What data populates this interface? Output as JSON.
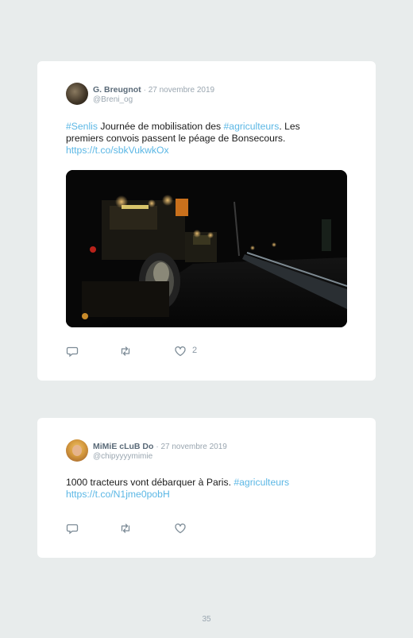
{
  "tweets": [
    {
      "author": "G. Breugnot",
      "date": "· 27 novembre 2019",
      "handle": "@Breni_og",
      "hashtag1": "#Senlis",
      "text1": " Journée de mobilisation des ",
      "hashtag2": "#agriculteurs",
      "text2": ". Les premiers convois passent le péage de Bonsecours.",
      "link": "https://t.co/sbkVukwkOx",
      "likes": "2"
    },
    {
      "author": "MiMiE cLuB Do",
      "date": "· 27 novembre 2019",
      "handle": "@chipyyyymimie",
      "text1": "1000 tracteurs vont débarquer à Paris. ",
      "hashtag1": "#agriculteurs",
      "link": "https://t.co/N1jme0pobH",
      "likes": ""
    }
  ],
  "page_number": "35",
  "icons": [
    "reply-icon",
    "retweet-icon",
    "heart-icon"
  ],
  "colors": {
    "link": "#5bb7e5",
    "muted": "#9aa6b0",
    "background": "#e8ecec"
  }
}
